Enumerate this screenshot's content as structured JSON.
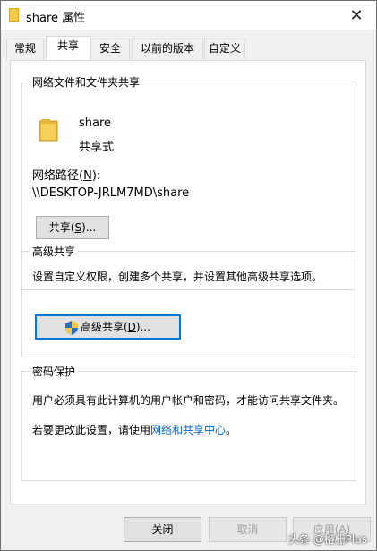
{
  "window": {
    "title": "share 属性",
    "close_label": "✕"
  },
  "tabs": [
    {
      "label": "常规"
    },
    {
      "label": "共享"
    },
    {
      "label": "安全"
    },
    {
      "label": "以前的版本"
    },
    {
      "label": "自定义"
    }
  ],
  "network_sharing": {
    "legend": "网络文件和文件夹共享",
    "folder_name": "share",
    "folder_status": "共享式",
    "path_label_prefix": "网络路径(",
    "path_label_key": "N",
    "path_label_suffix": "):",
    "path_value": "\\\\DESKTOP-JRLM7MD\\share",
    "share_button_prefix": "共享(",
    "share_button_key": "S",
    "share_button_suffix": ")..."
  },
  "advanced_sharing": {
    "legend": "高级共享",
    "description": "设置自定义权限，创建多个共享，并设置其他高级共享选项。",
    "button_prefix": "高级共享(",
    "button_key": "D",
    "button_suffix": ")..."
  },
  "password_protection": {
    "legend": "密码保护",
    "description": "用户必须具有此计算机的用户帐户和密码，才能访问共享文件夹。",
    "change_prefix": "若要更改此设置，请使用",
    "change_link": "网络和共享中心",
    "change_suffix": "。"
  },
  "footer": {
    "close_button": "关闭",
    "cancel_button": "取消",
    "apply_button": "应用(A)"
  },
  "watermark": "头条 @格栅Plus",
  "colors": {
    "accent": "#0078d7",
    "link": "#0066cc",
    "folder": "#f4c84b"
  }
}
